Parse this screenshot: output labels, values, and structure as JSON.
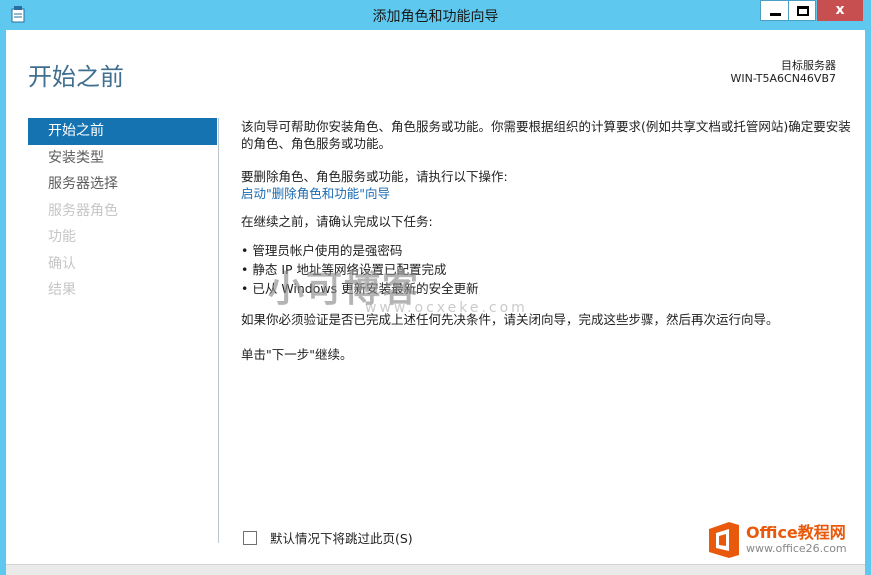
{
  "window": {
    "title": "添加角色和功能向导",
    "close_label": "x"
  },
  "header": {
    "page_title": "开始之前",
    "target_server_label": "目标服务器",
    "target_server_name": "WIN-T5A6CN46VB7"
  },
  "sidebar": {
    "items": [
      {
        "label": "开始之前",
        "state": "active"
      },
      {
        "label": "安装类型",
        "state": "enabled"
      },
      {
        "label": "服务器选择",
        "state": "enabled"
      },
      {
        "label": "服务器角色",
        "state": "disabled"
      },
      {
        "label": "功能",
        "state": "disabled"
      },
      {
        "label": "确认",
        "state": "disabled"
      },
      {
        "label": "结果",
        "state": "disabled"
      }
    ]
  },
  "content": {
    "intro": "该向导可帮助你安装角色、角色服务或功能。你需要根据组织的计算要求(例如共享文档或托管网站)确定要安装的角色、角色服务或功能。",
    "remove_text": "要删除角色、角色服务或功能，请执行以下操作:",
    "remove_link": "启动\"删除角色和功能\"向导",
    "before_continue": "在继续之前，请确认完成以下任务:",
    "tasks": [
      "• 管理员帐户使用的是强密码",
      "• 静态 IP 地址等网络设置已配置完成",
      "• 已从 Windows 更新安装最新的安全更新"
    ],
    "verify_text": "如果你必须验证是否已完成上述任何先决条件，请关闭向导，完成这些步骤，然后再次运行向导。",
    "continue_text": "单击\"下一步\"继续。"
  },
  "footer": {
    "skip_label": "默认情况下将跳过此页(S)",
    "skip_checked": false
  },
  "watermark": {
    "main": "小可博客",
    "url": "www.ocxeke.com",
    "badge_name": "Office教程网",
    "badge_site": "www.office26.com"
  },
  "colors": {
    "accent": "#1673b1",
    "title_bar": "#5ec8ef",
    "close_button": "#c74f50",
    "link": "#1a6bb2"
  }
}
